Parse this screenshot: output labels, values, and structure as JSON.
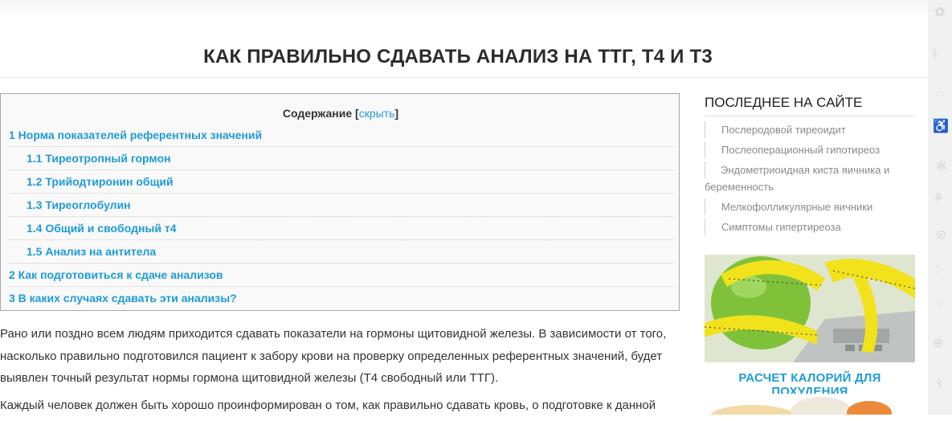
{
  "title": "КАК ПРАВИЛЬНО СДАВАТЬ АНАЛИЗ НА ТТГ, Т4 И Т3",
  "toc": {
    "heading": "Содержание",
    "toggle_open": "[",
    "toggle": "скрыть",
    "toggle_close": "]",
    "items": [
      {
        "label": "1 Норма показателей референтных значений",
        "level": 1
      },
      {
        "label": "1.1 Тиреотропный гормон",
        "level": 2
      },
      {
        "label": "1.2 Трийодтиронин общий",
        "level": 2
      },
      {
        "label": "1.3 Тиреоглобулин",
        "level": 2
      },
      {
        "label": "1.4 Общий и свободный т4",
        "level": 2
      },
      {
        "label": "1.5 Анализ на антитела",
        "level": 2
      },
      {
        "label": "2 Как подготовиться к сдаче анализов",
        "level": 1
      },
      {
        "label": "3 В каких случаях сдавать эти анализы?",
        "level": 1
      }
    ]
  },
  "article": {
    "p1": "Рано или поздно всем людям приходится сдавать показатели на гормоны щитовидной железы. В зависимости от того, насколько правильно подготовился пациент к забору крови на проверку определенных референтных значений, будет выявлен точный результат нормы гормона щитовидной железы (Т4 свободный или ТТГ).",
    "p2": "Каждый человек должен быть хорошо проинформирован о том, как правильно сдавать кровь, о подготовке к данной"
  },
  "sidebar": {
    "title": "ПОСЛЕДНЕЕ НА САЙТЕ",
    "items": [
      "Послеродовой тиреоидит",
      "Послеоперационный гипотиреоз",
      "Эндометриоидная киста яичника и беременность",
      "Мелкофолликулярные яичники",
      "Симптомы гипертиреоза"
    ],
    "promo_caption": "РАСЧЕТ КАЛОРИЙ ДЛЯ ПОХУДЕНИЯ"
  },
  "colors": {
    "link": "#1e9bd7",
    "text": "#333333",
    "muted": "#8a8a8a",
    "toc_bg": "#f9f9f9"
  }
}
